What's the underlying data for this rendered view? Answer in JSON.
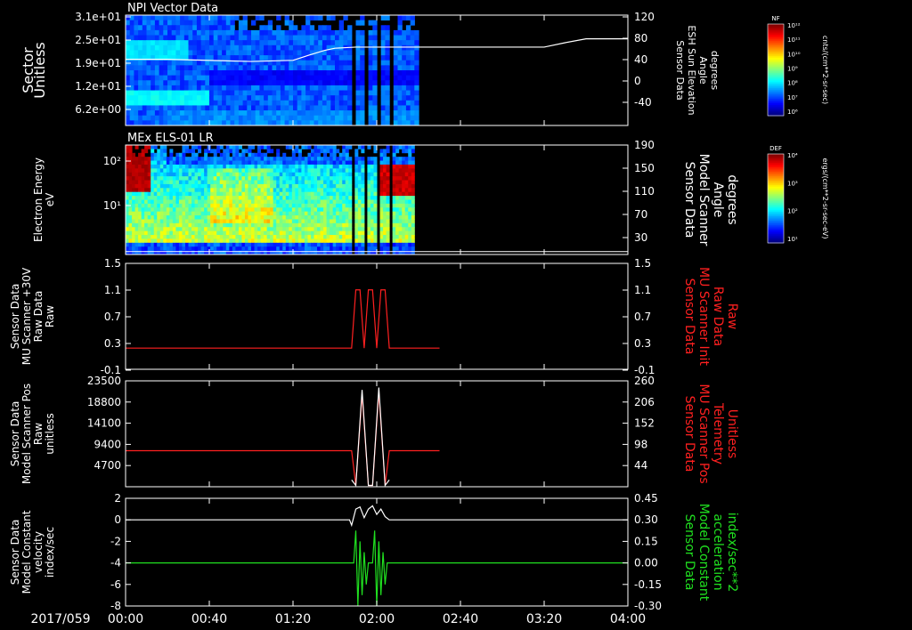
{
  "figure": {
    "date_label": "2017/059",
    "time_ticks": [
      "00:00",
      "00:40",
      "01:20",
      "02:00",
      "02:40",
      "03:20",
      "04:00"
    ],
    "time_range_min": [
      0,
      240
    ]
  },
  "colors": {
    "background": "#000000",
    "axis": "#ffffff",
    "red": "#ff2020",
    "green": "#20e020"
  },
  "chart_data": [
    {
      "type": "heatmap",
      "title": "NPI Vector Data",
      "ylabel_left": [
        "Sector",
        "Unitless"
      ],
      "yticks_left": [
        "3.1e+01",
        "2.5e+01",
        "1.9e+01",
        "1.2e+01",
        "6.2e+00"
      ],
      "ylabel_right": [
        "Sensor Data",
        "ESH Sun Elevation",
        "Angle",
        "degrees"
      ],
      "yticks_right": [
        "120",
        "80",
        "40",
        "0",
        "-40"
      ],
      "ylim_right": [
        -80,
        120
      ],
      "colorbar": {
        "label": "NF",
        "unit": "cnts/(cm**2-sr-sec)",
        "ticks": [
          "10¹²",
          "10¹¹",
          "10¹⁰",
          "10⁹",
          "10⁸",
          "10⁷",
          "10⁶"
        ]
      },
      "data_extent_min": [
        0,
        140
      ],
      "line": {
        "x": [
          0,
          20,
          40,
          60,
          80,
          88,
          95,
          100,
          110,
          120,
          130,
          140,
          160,
          180,
          200,
          210,
          220,
          240
        ],
        "y": [
          40,
          40,
          38,
          36,
          38,
          48,
          56,
          60,
          62,
          62,
          62,
          62,
          62,
          62,
          62,
          70,
          77,
          77
        ]
      }
    },
    {
      "type": "heatmap",
      "title": "MEx ELS-01 LR",
      "ylabel_left": [
        "Electron Energy",
        "eV"
      ],
      "yticks_left": [
        "10²",
        "10¹"
      ],
      "ylabel_right": [
        "Sensor Data",
        "Model Scanner",
        "Angle",
        "degrees"
      ],
      "yticks_right": [
        "190",
        "150",
        "110",
        "70",
        "30"
      ],
      "ylim_right": [
        0,
        190
      ],
      "colorbar": {
        "label": "DEF",
        "unit": "ergs/(cm**2-sr-sec-eV)",
        "ticks": [
          "10⁴",
          "10³",
          "10²",
          "10¹"
        ]
      },
      "data_extent_min": [
        0,
        138
      ],
      "line": {
        "x": [
          0,
          240
        ],
        "y": [
          5,
          5
        ]
      }
    },
    {
      "type": "line",
      "ylabel_left": [
        "Sensor Data",
        "MU Scanner +30V",
        "Raw Data",
        "Raw"
      ],
      "yticks_left": [
        "1.5",
        "1.1",
        "0.7",
        "0.3",
        "-0.1"
      ],
      "ylabel_right": [
        "Sensor Data",
        "MU Scanner Init",
        "Raw Data",
        "Raw"
      ],
      "yticks_right": [
        "1.5",
        "1.1",
        "0.7",
        "0.3",
        "-0.1"
      ],
      "ylim": [
        -0.5,
        1.5
      ],
      "series": [
        {
          "color": "red",
          "x": [
            0,
            108,
            110,
            112,
            114,
            116,
            118,
            120,
            122,
            124,
            126,
            150
          ],
          "y": [
            -0.1,
            -0.1,
            1.0,
            1.0,
            -0.1,
            1.0,
            1.0,
            -0.1,
            1.0,
            1.0,
            -0.1,
            -0.1
          ]
        }
      ]
    },
    {
      "type": "line",
      "ylabel_left": [
        "Sensor Data",
        "Model Scanner Pos",
        "Raw",
        "unitless"
      ],
      "yticks_left": [
        "23500",
        "18800",
        "14100",
        "9400",
        "4700"
      ],
      "ylabel_right": [
        "Sensor Data",
        "MU Scanner Pos",
        "Telemetry",
        "Unitless"
      ],
      "yticks_right": [
        "260",
        "206",
        "152",
        "98",
        "44"
      ],
      "ylim": [
        0,
        23500
      ],
      "series": [
        {
          "color": "red",
          "x": [
            0,
            108,
            110,
            113,
            116,
            118,
            121,
            124,
            126,
            150
          ],
          "y": [
            8000,
            8000,
            300,
            20500,
            300,
            300,
            21000,
            300,
            8000,
            8000
          ]
        },
        {
          "color": "white",
          "x": [
            108,
            110,
            113,
            116,
            118,
            121,
            124,
            126
          ],
          "y": [
            1500,
            300,
            21500,
            300,
            300,
            22000,
            300,
            1500
          ]
        }
      ]
    },
    {
      "type": "line",
      "ylabel_left": [
        "Sensor Data",
        "Model Constant",
        "velocity",
        "index/sec"
      ],
      "yticks_left": [
        "2",
        "0",
        "-2",
        "-4",
        "-6",
        "-8"
      ],
      "ylabel_right": [
        "Sensor Data",
        "Model Constant",
        "acceleration",
        "index/sec**2"
      ],
      "yticks_right": [
        "0.45",
        "0.30",
        "0.15",
        "0.00",
        "-0.15",
        "-0.30"
      ],
      "ylim": [
        -8,
        2
      ],
      "series": [
        {
          "color": "white",
          "x": [
            0,
            107,
            108,
            110,
            112,
            114,
            116,
            118,
            120,
            122,
            124,
            126,
            240
          ],
          "y": [
            0,
            0,
            -0.5,
            1.0,
            1.2,
            0.2,
            1.0,
            1.3,
            0.5,
            1.0,
            0.3,
            0,
            0
          ]
        },
        {
          "color": "green",
          "x": [
            0,
            109,
            110,
            111,
            112,
            113,
            114,
            115,
            116,
            118,
            119,
            120,
            121,
            122,
            123,
            124,
            125,
            126,
            240
          ],
          "y": [
            -4,
            -4,
            -1,
            -8,
            -2,
            -7,
            -3,
            -6,
            -4,
            -4,
            -1,
            -8,
            -2,
            -7,
            -3,
            -6,
            -4,
            -4,
            -4
          ]
        }
      ]
    }
  ]
}
